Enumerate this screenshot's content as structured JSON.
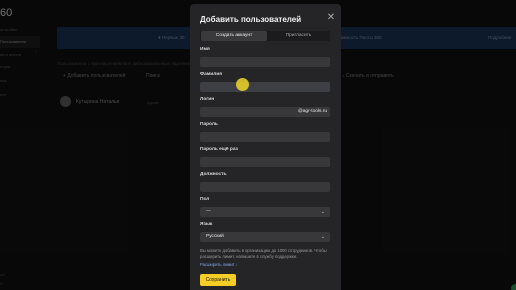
{
  "background": {
    "logo": "60",
    "sidebar_items": [
      "астройки",
      "Пользователи",
      "ия и агента",
      "ступа",
      "нии",
      "ент"
    ],
    "footer_items": [
      "ые",
      "О"
    ],
    "banner_left": "♥ Первые 30",
    "banner_mid": "амность Почты 360",
    "banner_right": "Подробнее",
    "list_hint": "Пользователи с приглашением    Все    Заблокированные    Удалённые",
    "add_user": "+ Добавить пользователей",
    "search": "Поиск",
    "invite_hint": "↓ Скачать и отправить",
    "user_name": "Кутырина Наталья",
    "user_role": "Админ"
  },
  "modal": {
    "title": "Добавить пользователей",
    "tabs": [
      "Создать аккаунт",
      "Пригласить"
    ],
    "fields": {
      "first_name_label": "Имя",
      "last_name_label": "Фамилия",
      "login_label": "Логин",
      "login_suffix": "@agr-tools.ru",
      "password_label": "Пароль",
      "password_repeat_label": "Пароль ещё раз",
      "position_label": "Должность",
      "gender_label": "Пол",
      "gender_value": "—",
      "language_label": "Язык",
      "language_value": "Русский"
    },
    "note": "Вы можете добавить в организацию до 1000 сотрудников. Чтобы расширить лимит, напишите в службу поддержки.",
    "note_link": "Расширить лимит ↓",
    "save_label": "Сохранить"
  }
}
